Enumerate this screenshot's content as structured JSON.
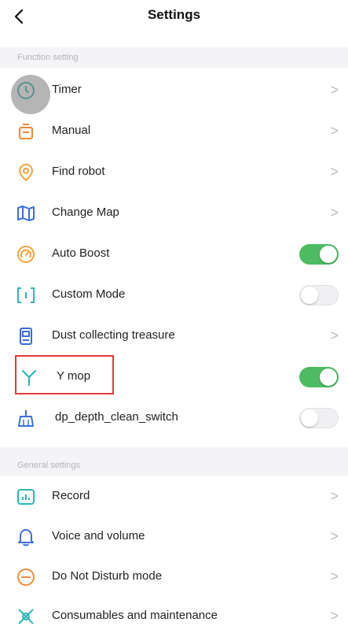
{
  "header": {
    "title": "Settings",
    "back_icon": "chevron-left-icon"
  },
  "sections": {
    "function": "Function setting",
    "general": "General settings"
  },
  "rows": {
    "timer": {
      "label": "Timer",
      "icon": "clock-icon"
    },
    "manual": {
      "label": "Manual",
      "icon": "manual-control-icon"
    },
    "find_robot": {
      "label": "Find robot",
      "icon": "location-pin-icon"
    },
    "change_map": {
      "label": "Change Map",
      "icon": "map-icon"
    },
    "auto_boost": {
      "label": "Auto Boost",
      "icon": "speedometer-icon",
      "toggle": true
    },
    "custom_mode": {
      "label": "Custom Mode",
      "icon": "custom-mode-icon",
      "toggle": false
    },
    "dust": {
      "label": "Dust collecting treasure",
      "icon": "dust-station-icon"
    },
    "y_mop": {
      "label": "Y mop",
      "icon": "y-mop-icon",
      "toggle": true
    },
    "depth_clean": {
      "label": "dp_depth_clean_switch",
      "icon": "broom-icon",
      "toggle": false
    },
    "record": {
      "label": "Record",
      "icon": "record-chart-icon"
    },
    "voice": {
      "label": "Voice and volume",
      "icon": "bell-icon"
    },
    "dnd": {
      "label": "Do Not Disturb mode",
      "icon": "do-not-disturb-icon"
    },
    "consumables": {
      "label": "Consumables and maintenance",
      "icon": "brush-icon"
    }
  },
  "chevron_glyph": ">",
  "colors": {
    "accent_orange": "#f2a33a",
    "accent_blue": "#3a7ee0",
    "accent_teal": "#2bb6b6",
    "toggle_on": "#4cbb62",
    "highlight_border": "#e03a3a"
  }
}
